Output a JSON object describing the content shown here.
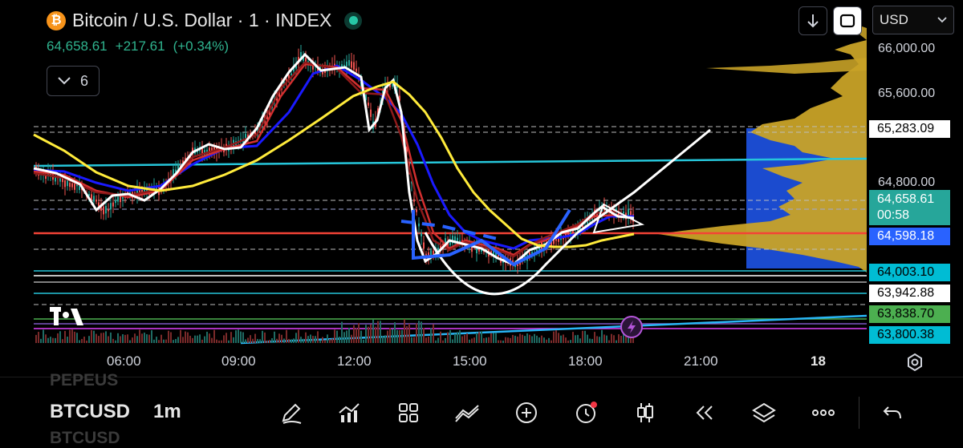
{
  "header": {
    "symbol_icon": "bitcoin-icon",
    "title": "Bitcoin / U.S. Dollar · 1 · INDEX",
    "last_price": "64,658.61",
    "change": "+217.61",
    "change_pct": "(+0.34%)",
    "change_color": "#2fb38e"
  },
  "indicators_toggle": {
    "count": "6"
  },
  "top_controls": {
    "currency": "USD"
  },
  "price_axis": {
    "ticks": [
      "66,000.00",
      "65,600.00",
      "64,800.00"
    ],
    "tags": [
      {
        "label": "65,283.09",
        "bg": "#ffffff",
        "fg": "#000000"
      },
      {
        "label": "64,658.61",
        "sub": "00:58",
        "bg": "#26a69a",
        "fg": "#ffffff"
      },
      {
        "label": "64,598.18",
        "bg": "#2962ff",
        "fg": "#ffffff"
      },
      {
        "label": "64,003.10",
        "bg": "#00bcd4",
        "fg": "#000000"
      },
      {
        "label": "63,942.88",
        "bg": "#ffffff",
        "fg": "#000000"
      },
      {
        "label": "63,838.70",
        "bg": "#4caf50",
        "fg": "#000000"
      },
      {
        "label": "63,800.38",
        "bg": "#00bcd4",
        "fg": "#000000"
      }
    ]
  },
  "time_axis": {
    "labels": [
      "06:00",
      "09:00",
      "12:00",
      "15:00",
      "18:00",
      "21:00"
    ],
    "date_label": "18"
  },
  "toolbar": {
    "ghost_top": "PEPEUS",
    "symbol": "BTCUSD",
    "interval": "1m",
    "ghost_bottom": "BTCUSD",
    "buttons": [
      "pencil-icon",
      "indicators-icon",
      "grid-icon",
      "trend-line-icon",
      "plus-icon",
      "alert-clock-icon",
      "candles-icon",
      "replay-icon",
      "layers-icon",
      "more-icon",
      "undo-icon"
    ]
  },
  "colors": {
    "up": "#26a69a",
    "down": "#ef5350",
    "ema_white": "#ffffff",
    "ema_red": "#d32f2f",
    "ema_blue": "#1a1aff",
    "ema_yellow": "#ffeb3b",
    "cyan_line": "#26c6da",
    "red_line": "#f44336",
    "volume_profile": "#c8a227",
    "volume_blue": "#1e53e5"
  }
}
